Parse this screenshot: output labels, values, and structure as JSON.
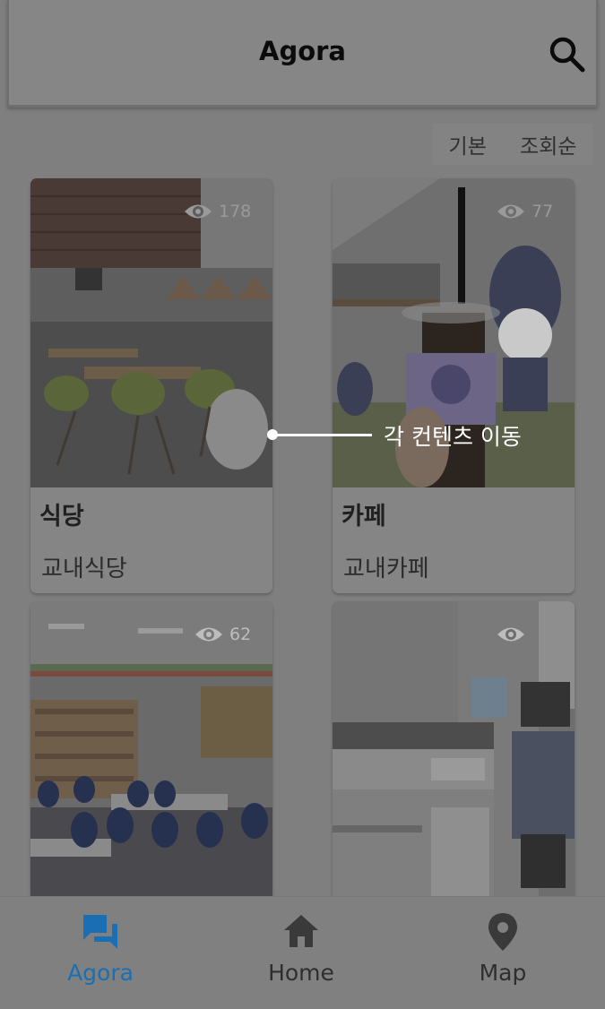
{
  "appbar": {
    "title": "Agora",
    "search_icon": "search-icon"
  },
  "sort": {
    "default_label": "기본",
    "views_label": "조회순"
  },
  "cards": [
    {
      "name": "식당",
      "desc": "교내식당",
      "views": "178"
    },
    {
      "name": "카페",
      "desc": "교내카페",
      "views": "77"
    },
    {
      "views": "62"
    },
    {
      "views": ""
    }
  ],
  "callout": {
    "text": "각 컨텐츠 이동"
  },
  "nav": {
    "agora_label": "Agora",
    "home_label": "Home",
    "map_label": "Map",
    "active_color": "#1a6fb4"
  }
}
